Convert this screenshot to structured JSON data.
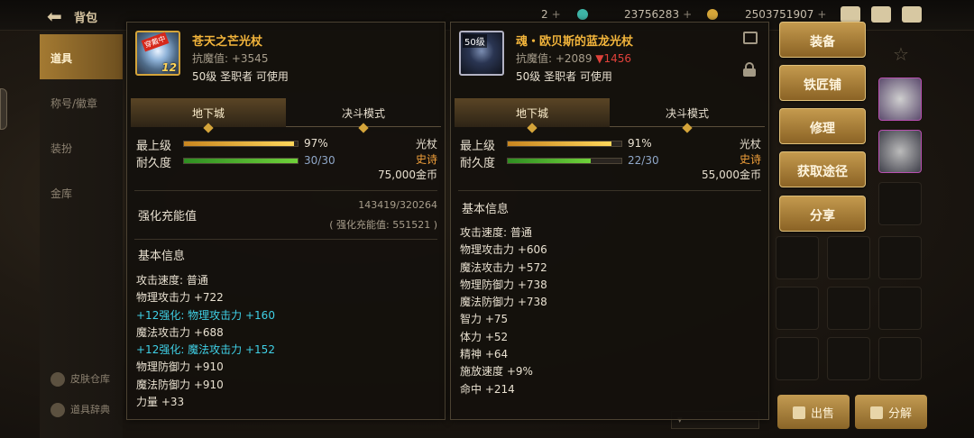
{
  "top_bar": {
    "title": "背包",
    "back_arrow": "back-arrow-icon",
    "currency_2_value": "2",
    "currency_gold_value": "23756283",
    "currency_coin_value": "2503751907"
  },
  "left_nav": {
    "items": [
      {
        "label": "道具",
        "active": true
      },
      {
        "label": "称号/徽章",
        "active": false
      },
      {
        "label": "装扮",
        "active": false
      },
      {
        "label": "金库",
        "active": false
      }
    ],
    "bottom": [
      {
        "label": "皮肤仓库"
      },
      {
        "label": "道具辞典"
      }
    ]
  },
  "item_left": {
    "name": "苍天之芒光杖",
    "equipped_badge": "穿戴中",
    "enhance_badge": "12",
    "resist": "抗魔值: +3545",
    "requirement": "50级 圣职者 可使用",
    "tabs": [
      "地下城",
      "决斗模式"
    ],
    "grade_label": "最上级",
    "grade_value": "97%",
    "grade_fraction": 0.97,
    "durability_label": "耐久度",
    "durability_value": "30/30",
    "durability_fraction": 1.0,
    "weapon_type": "光杖",
    "rarity": "史诗",
    "price": "75,000金币",
    "charge_label": "强化充能值",
    "charge_value": "143419/320264",
    "charge_sub": "( 强化充能值: 551521 )",
    "basic_title": "基本信息",
    "attributes": [
      {
        "text": "攻击速度: 普通",
        "enh": false
      },
      {
        "text": "物理攻击力 +722",
        "enh": false
      },
      {
        "text": "+12强化: 物理攻击力 +160",
        "enh": true
      },
      {
        "text": "魔法攻击力 +688",
        "enh": false
      },
      {
        "text": "+12强化: 魔法攻击力 +152",
        "enh": true
      },
      {
        "text": "物理防御力 +910",
        "enh": false
      },
      {
        "text": "魔法防御力 +910",
        "enh": false
      },
      {
        "text": "力量 +33",
        "enh": false
      }
    ]
  },
  "item_right": {
    "name": "魂・欧贝斯的蓝龙光杖",
    "level_badge": "50级",
    "resist": "抗魔值: +2089",
    "resist_diff": "▼1456",
    "requirement": "50级 圣职者 可使用",
    "tabs": [
      "地下城",
      "决斗模式"
    ],
    "grade_label": "最上级",
    "grade_value": "91%",
    "grade_fraction": 0.91,
    "durability_label": "耐久度",
    "durability_value": "22/30",
    "durability_fraction": 0.733,
    "weapon_type": "光杖",
    "rarity": "史诗",
    "price": "55,000金币",
    "basic_title": "基本信息",
    "attributes": [
      {
        "text": "攻击速度: 普通"
      },
      {
        "text": "物理攻击力 +606"
      },
      {
        "text": "魔法攻击力 +572"
      },
      {
        "text": "物理防御力 +738"
      },
      {
        "text": "魔法防御力 +738"
      },
      {
        "text": "智力 +75"
      },
      {
        "text": "体力 +52"
      },
      {
        "text": "精神 +64"
      },
      {
        "text": "施放速度 +9%"
      },
      {
        "text": "命中 +214"
      }
    ]
  },
  "actions": [
    "装备",
    "铁匠铺",
    "修理",
    "获取途径",
    "分享"
  ],
  "bottom_buttons": {
    "sell": "出售",
    "disassemble": "分解"
  },
  "colors": {
    "accent_gold": "#d4a43a",
    "item_name": "#f2b43b",
    "rarity_epic": "#f2a13b",
    "enhance_cyan": "#3fd0e6",
    "decrease_red": "#e0413a"
  }
}
